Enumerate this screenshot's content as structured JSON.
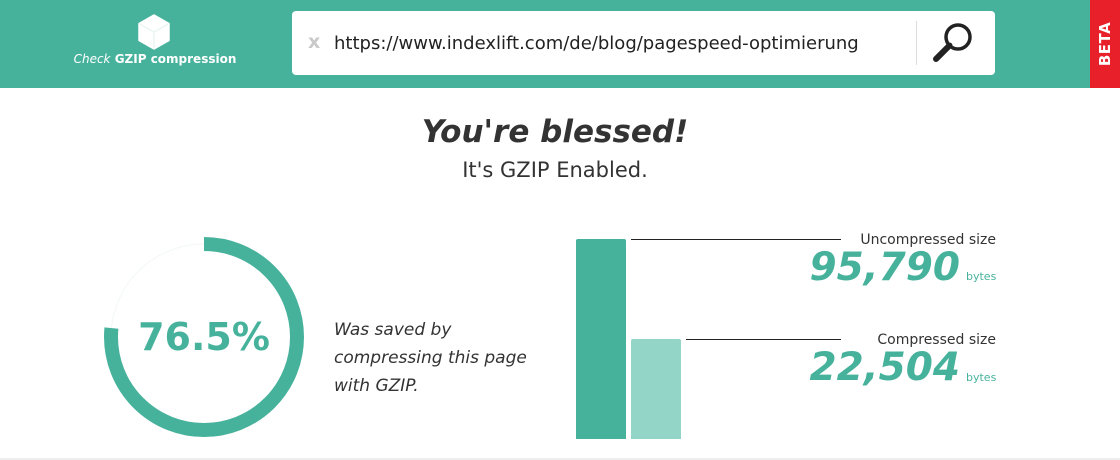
{
  "header": {
    "logo_text_italic": "Check",
    "logo_text_bold": "GZIP compression",
    "search": {
      "clear_label": "x",
      "url_value": "https://www.indexlift.com/de/blog/pagespeed-optimierung"
    },
    "beta_label": "BETA"
  },
  "result": {
    "headline": "You're blessed!",
    "subline": "It's GZIP Enabled."
  },
  "savings": {
    "percent_label": "76.5%",
    "percent_value": 76.5,
    "description_lines": [
      "Was saved by",
      "compressing this page",
      "with GZIP."
    ]
  },
  "sizes": {
    "uncompressed": {
      "label": "Uncompressed size",
      "value_text": "95,790",
      "value": 95790,
      "unit": "bytes"
    },
    "compressed": {
      "label": "Compressed size",
      "value_text": "22,504",
      "value": 22504,
      "unit": "bytes"
    }
  },
  "colors": {
    "brand": "#47b29c",
    "brand_light": "#93d5c7",
    "beta": "#e8202a"
  },
  "icons": {
    "logo": "hexagon-icon",
    "search": "magnifier-icon",
    "clear": "clear-icon"
  }
}
